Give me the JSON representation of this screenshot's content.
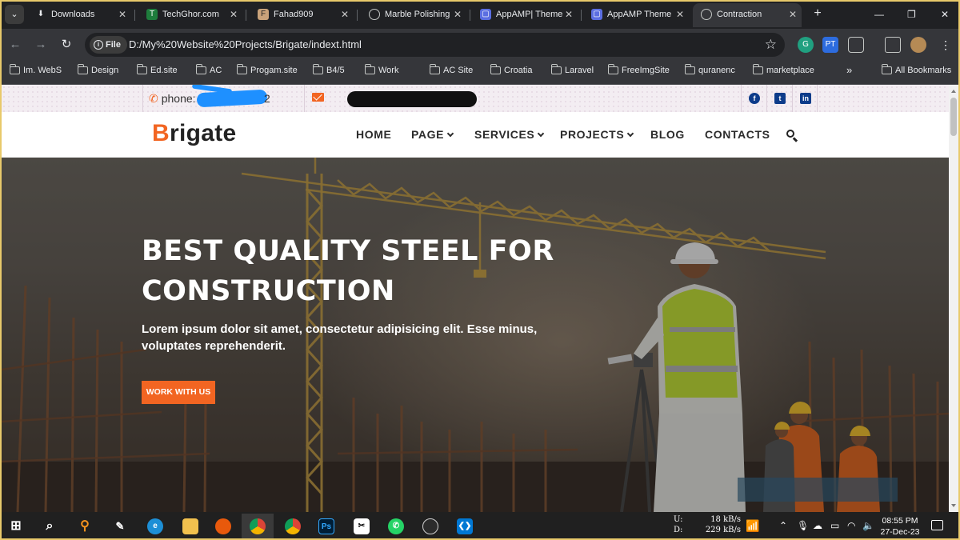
{
  "browser": {
    "tabs": [
      {
        "title": "Downloads",
        "icon": "download-icon"
      },
      {
        "title": "TechGhor.com",
        "icon": "techghor-favicon"
      },
      {
        "title": "Fahad909",
        "icon": "profile-favicon"
      },
      {
        "title": "Marble Polishing",
        "icon": "globe-icon"
      },
      {
        "title": "AppAMP| Theme",
        "icon": "appamp-favicon"
      },
      {
        "title": "AppAMP Theme",
        "icon": "appamp-favicon"
      },
      {
        "title": "Contraction",
        "icon": "globe-icon",
        "active": true
      }
    ],
    "new_tab": "+",
    "site_info_label": "File",
    "url": "D:/My%20Website%20Projects/Brigate/indext.html",
    "bookmarks": [
      {
        "label": "Im. WebS"
      },
      {
        "label": "Design"
      },
      {
        "label": "Ed.site"
      },
      {
        "label": "AC"
      },
      {
        "label": "Progam.site"
      },
      {
        "label": "B4/5"
      },
      {
        "label": "Work"
      },
      {
        "label": "AC Site"
      },
      {
        "label": "Croatia"
      },
      {
        "label": "Laravel"
      },
      {
        "label": "FreeImgSite"
      },
      {
        "label": "quranenc"
      },
      {
        "label": "marketplace"
      }
    ],
    "more_bookmarks": "»",
    "all_bookmarks": "All Bookmarks"
  },
  "site": {
    "topbar": {
      "phone_label": "phone:",
      "phone_tail": "2",
      "socials": [
        "facebook-icon",
        "twitter-icon",
        "linkedin-icon"
      ]
    },
    "logo": {
      "first_letter": "B",
      "rest": "rigate"
    },
    "nav": [
      {
        "label": "HOME",
        "dropdown": false
      },
      {
        "label": "PAGE",
        "dropdown": true
      },
      {
        "label": "SERVICES",
        "dropdown": true
      },
      {
        "label": "PROJECTS",
        "dropdown": true
      },
      {
        "label": "BLOG",
        "dropdown": false
      },
      {
        "label": "CONTACTS",
        "dropdown": false
      }
    ],
    "hero": {
      "title_line1": "BEST QUALITY STEEL FOR",
      "title_line2": "CONSTRUCTION",
      "subtitle": "Lorem ipsum dolor sit amet, consectetur adipisicing elit. Esse minus, voluptates reprehenderit.",
      "cta": "WORK WITH US"
    },
    "accent_color": "#f26522",
    "social_icon_color": "#0d3c8a"
  },
  "taskbar": {
    "apps": [
      "windows-start-icon",
      "search-icon",
      "search-tool-icon",
      "pen-icon",
      "edge-icon",
      "file-explorer-icon",
      "firefox-icon",
      "chrome-icon",
      "chrome-profile-icon",
      "photoshop-icon",
      "capcut-icon",
      "whatsapp-icon",
      "obs-icon",
      "vscode-icon"
    ],
    "net_up_label": "U:",
    "net_up_value": "18 kB/s",
    "net_down_label": "D:",
    "net_down_value": "229 kB/s",
    "time": "08:55 PM",
    "date": "27-Dec-23"
  }
}
